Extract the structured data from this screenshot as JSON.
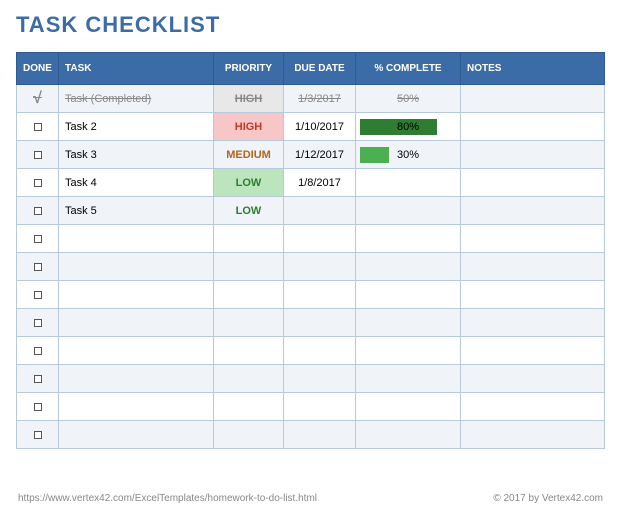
{
  "title": "TASK CHECKLIST",
  "headers": {
    "done": "DONE",
    "task": "TASK",
    "priority": "PRIORITY",
    "due_date": "DUE DATE",
    "pct_complete": "% COMPLETE",
    "notes": "NOTES"
  },
  "rows": [
    {
      "done": true,
      "task": "Task (Completed)",
      "priority": "HIGH",
      "priority_style": "done",
      "due_date": "1/3/2017",
      "pct": "50%",
      "pct_val": 50,
      "bar_style": "none",
      "notes": ""
    },
    {
      "done": false,
      "task": "Task 2",
      "priority": "HIGH",
      "priority_style": "high",
      "due_date": "1/10/2017",
      "pct": "80%",
      "pct_val": 80,
      "bar_style": "dark",
      "notes": ""
    },
    {
      "done": false,
      "task": "Task 3",
      "priority": "MEDIUM",
      "priority_style": "medium",
      "due_date": "1/12/2017",
      "pct": "30%",
      "pct_val": 30,
      "bar_style": "light",
      "notes": ""
    },
    {
      "done": false,
      "task": "Task 4",
      "priority": "LOW",
      "priority_style": "low",
      "due_date": "1/8/2017",
      "pct": "",
      "pct_val": 0,
      "bar_style": "none",
      "notes": ""
    },
    {
      "done": false,
      "task": "Task 5",
      "priority": "LOW",
      "priority_style": "low",
      "due_date": "",
      "pct": "",
      "pct_val": 0,
      "bar_style": "none",
      "notes": ""
    },
    {
      "done": false,
      "task": "",
      "priority": "",
      "priority_style": "",
      "due_date": "",
      "pct": "",
      "pct_val": 0,
      "bar_style": "none",
      "notes": ""
    },
    {
      "done": false,
      "task": "",
      "priority": "",
      "priority_style": "",
      "due_date": "",
      "pct": "",
      "pct_val": 0,
      "bar_style": "none",
      "notes": ""
    },
    {
      "done": false,
      "task": "",
      "priority": "",
      "priority_style": "",
      "due_date": "",
      "pct": "",
      "pct_val": 0,
      "bar_style": "none",
      "notes": ""
    },
    {
      "done": false,
      "task": "",
      "priority": "",
      "priority_style": "",
      "due_date": "",
      "pct": "",
      "pct_val": 0,
      "bar_style": "none",
      "notes": ""
    },
    {
      "done": false,
      "task": "",
      "priority": "",
      "priority_style": "",
      "due_date": "",
      "pct": "",
      "pct_val": 0,
      "bar_style": "none",
      "notes": ""
    },
    {
      "done": false,
      "task": "",
      "priority": "",
      "priority_style": "",
      "due_date": "",
      "pct": "",
      "pct_val": 0,
      "bar_style": "none",
      "notes": ""
    },
    {
      "done": false,
      "task": "",
      "priority": "",
      "priority_style": "",
      "due_date": "",
      "pct": "",
      "pct_val": 0,
      "bar_style": "none",
      "notes": ""
    },
    {
      "done": false,
      "task": "",
      "priority": "",
      "priority_style": "",
      "due_date": "",
      "pct": "",
      "pct_val": 0,
      "bar_style": "none",
      "notes": ""
    }
  ],
  "footer": {
    "url": "https://www.vertex42.com/ExcelTemplates/homework-to-do-list.html",
    "copyright": "© 2017 by Vertex42.com"
  },
  "chart_data": {
    "type": "table",
    "title": "TASK CHECKLIST",
    "columns": [
      "DONE",
      "TASK",
      "PRIORITY",
      "DUE DATE",
      "% COMPLETE",
      "NOTES"
    ],
    "rows": [
      [
        "✓",
        "Task (Completed)",
        "HIGH",
        "1/3/2017",
        "50%",
        ""
      ],
      [
        "",
        "Task 2",
        "HIGH",
        "1/10/2017",
        "80%",
        ""
      ],
      [
        "",
        "Task 3",
        "MEDIUM",
        "1/12/2017",
        "30%",
        ""
      ],
      [
        "",
        "Task 4",
        "LOW",
        "1/8/2017",
        "",
        ""
      ],
      [
        "",
        "Task 5",
        "LOW",
        "",
        "",
        ""
      ]
    ]
  }
}
